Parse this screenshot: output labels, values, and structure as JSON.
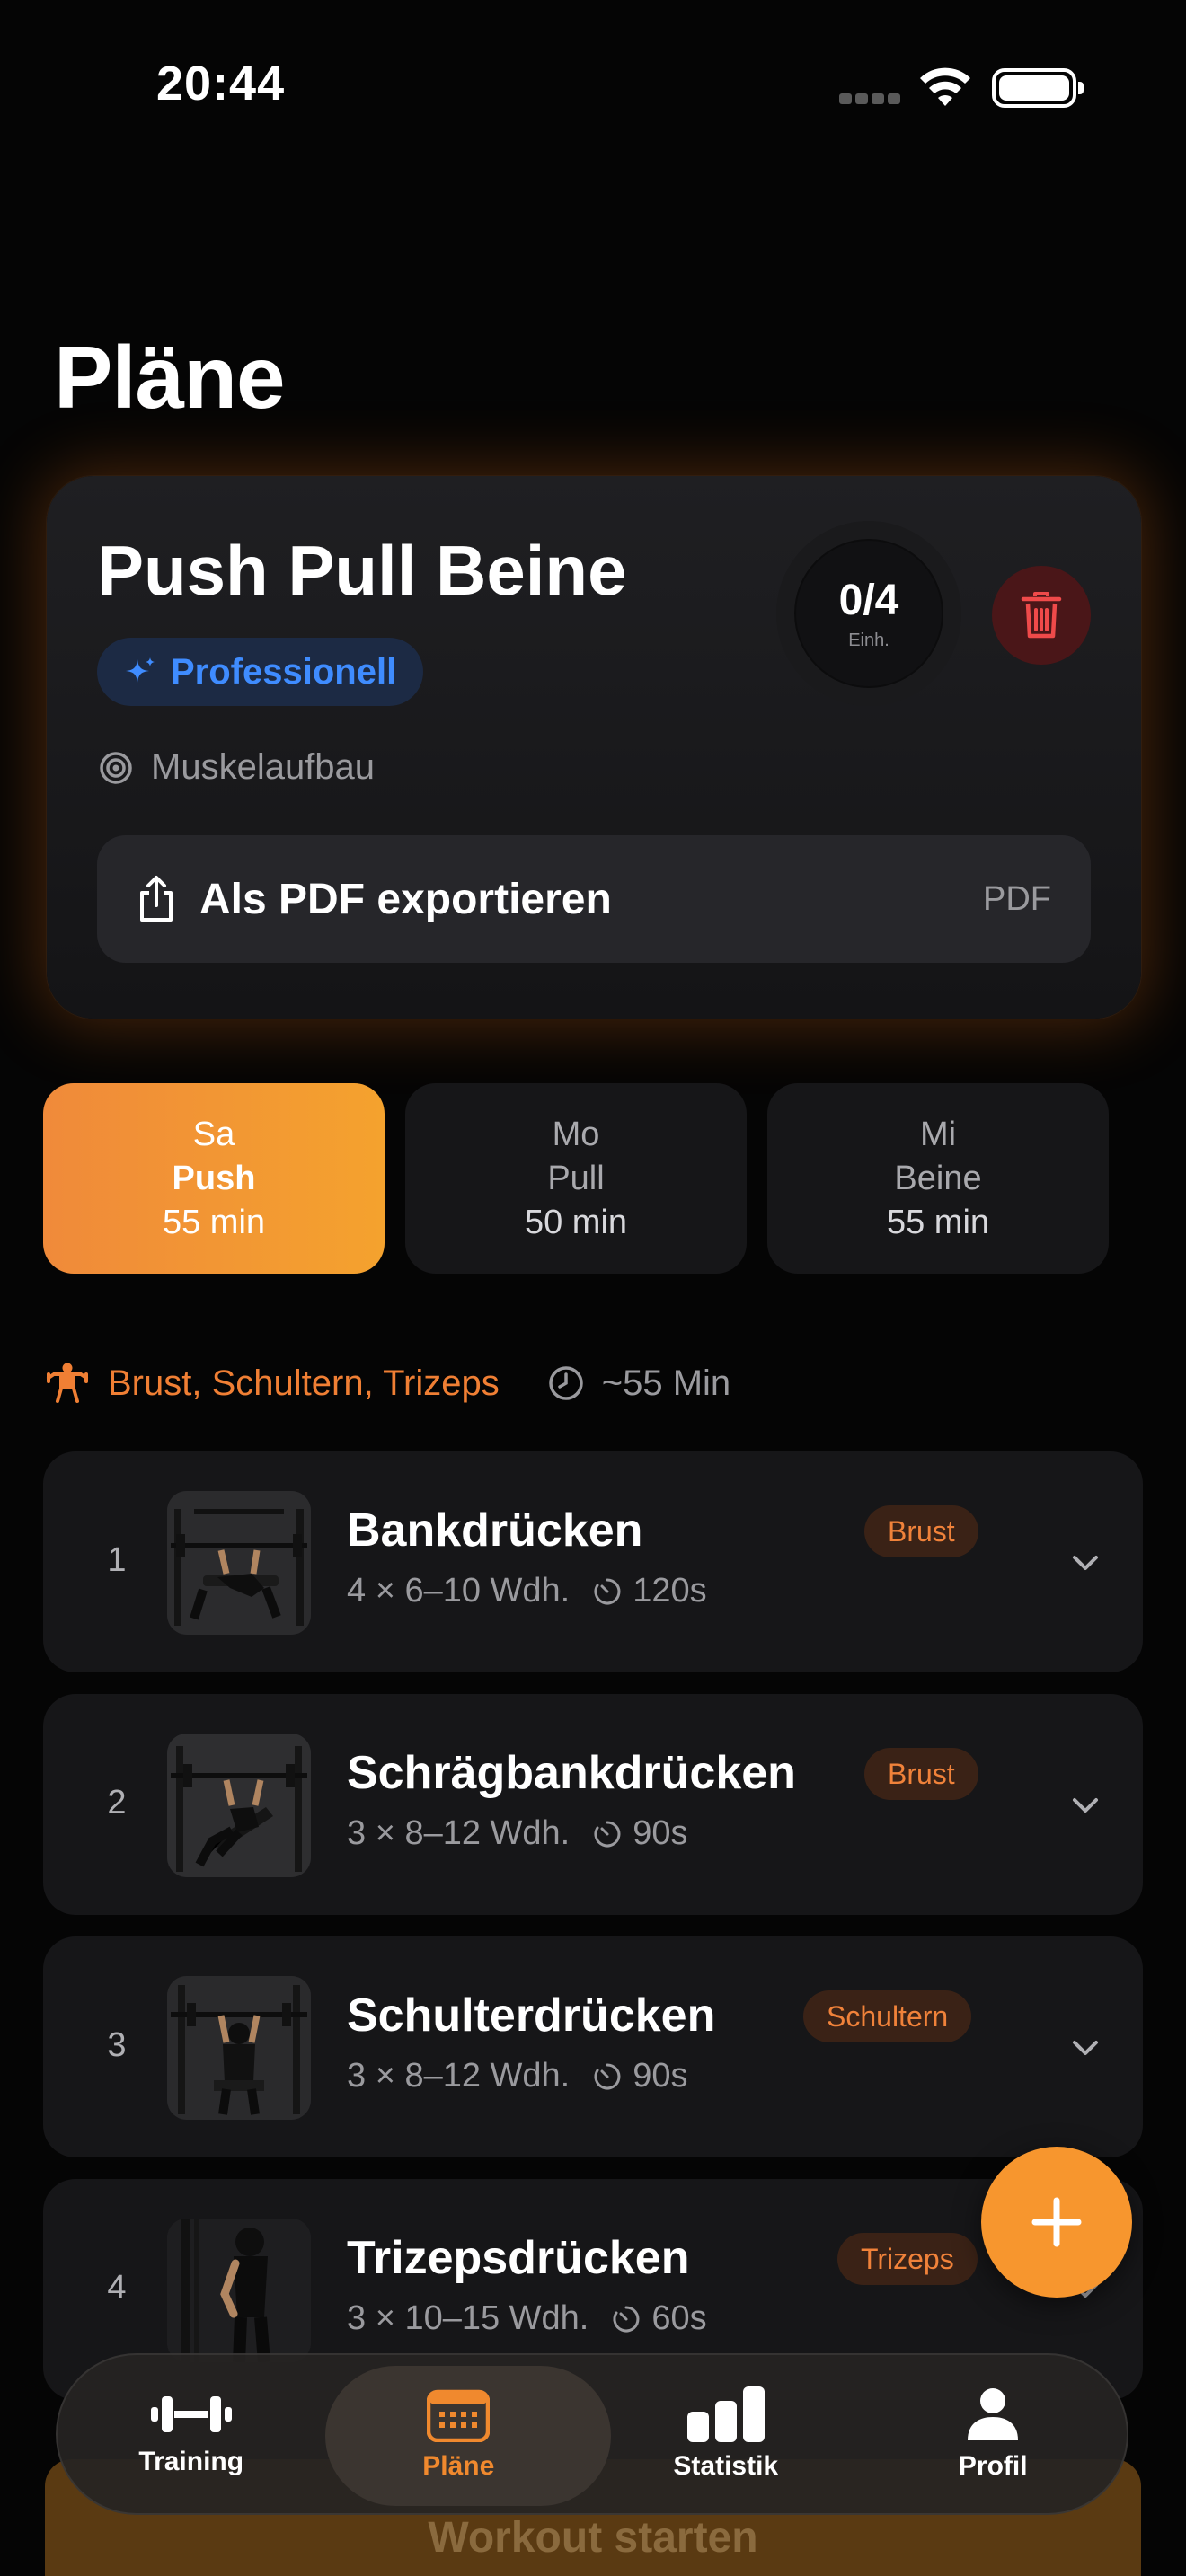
{
  "status_bar": {
    "time": "20:44"
  },
  "page_title": "Pläne",
  "plan": {
    "name": "Push Pull Beine",
    "level": "Professionell",
    "goal": "Muskelaufbau",
    "progress": {
      "value": "0/4",
      "unit": "Einh."
    },
    "export_label": "Als PDF exportieren",
    "export_tag": "PDF"
  },
  "days": [
    {
      "day": "Sa",
      "focus": "Push",
      "duration": "55 min",
      "active": true
    },
    {
      "day": "Mo",
      "focus": "Pull",
      "duration": "50 min",
      "active": false
    },
    {
      "day": "Mi",
      "focus": "Beine",
      "duration": "55 min",
      "active": false
    }
  ],
  "session_info": {
    "muscles": "Brust, Schultern, Trizeps",
    "duration": "~55 Min"
  },
  "exercises": [
    {
      "num": "1",
      "name": "Bankdrücken",
      "sets": "4 × 6–10 Wdh.",
      "rest": "120s",
      "tag": "Brust"
    },
    {
      "num": "2",
      "name": "Schrägbankdrücken",
      "sets": "3 × 8–12 Wdh.",
      "rest": "90s",
      "tag": "Brust"
    },
    {
      "num": "3",
      "name": "Schulterdrücken",
      "sets": "3 × 8–12 Wdh.",
      "rest": "90s",
      "tag": "Schultern"
    },
    {
      "num": "4",
      "name": "Trizepsdrücken",
      "sets": "3 × 10–15 Wdh.",
      "rest": "60s",
      "tag": "Trizeps"
    }
  ],
  "start_button": "Workout starten",
  "tabbar": [
    {
      "label": "Training",
      "icon": "dumbbell-icon"
    },
    {
      "label": "Pläne",
      "icon": "calendar-icon",
      "active": true
    },
    {
      "label": "Statistik",
      "icon": "bar-chart-icon"
    },
    {
      "label": "Profil",
      "icon": "person-icon"
    }
  ],
  "colors": {
    "accent": "#F39333",
    "blue": "#3F8CFF",
    "danger": "#E5484D",
    "background": "#050505"
  }
}
